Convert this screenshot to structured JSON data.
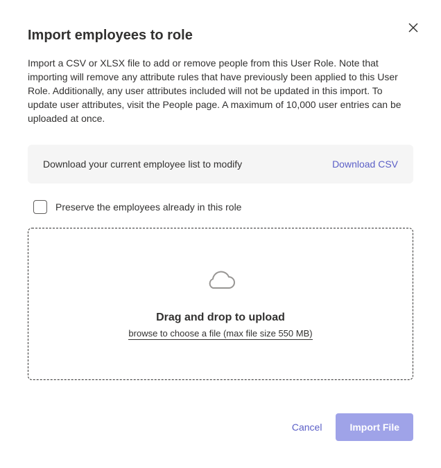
{
  "dialog": {
    "title": "Import employees to role",
    "description": "Import a CSV or XLSX file to add or remove people from this User Role. Note that importing will remove any attribute rules that have previously been applied to this User Role. Additionally, any user attributes included will not be updated in this import. To update user attributes, visit the People page. A maximum of 10,000 user entries can be uploaded at once."
  },
  "downloadPanel": {
    "text": "Download your current employee list to modify",
    "linkLabel": "Download CSV"
  },
  "checkbox": {
    "label": "Preserve the employees already in this role",
    "checked": false
  },
  "dropzone": {
    "title": "Drag and drop to upload",
    "subtitle": "browse to choose a file (max file size 550 MB)"
  },
  "footer": {
    "cancelLabel": "Cancel",
    "importLabel": "Import File"
  }
}
